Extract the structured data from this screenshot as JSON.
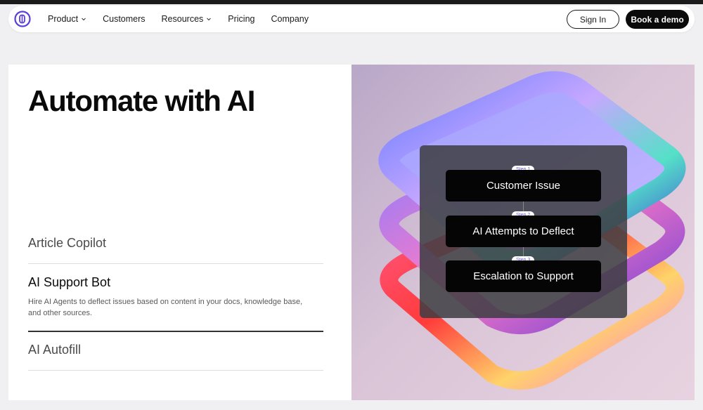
{
  "nav": {
    "items": [
      {
        "label": "Product",
        "dropdown": true
      },
      {
        "label": "Customers",
        "dropdown": false
      },
      {
        "label": "Resources",
        "dropdown": true
      },
      {
        "label": "Pricing",
        "dropdown": false
      },
      {
        "label": "Company",
        "dropdown": false
      }
    ],
    "signin_label": "Sign In",
    "demo_label": "Book a demo"
  },
  "hero": {
    "title": "Automate with AI"
  },
  "features": [
    {
      "title": "Article Copilot",
      "active": false
    },
    {
      "title": "AI Support Bot",
      "active": true,
      "description": "Hire AI Agents to deflect issues based on content in your docs, knowledge base, and other sources."
    },
    {
      "title": "AI Autofill",
      "active": false
    }
  ],
  "flow": {
    "steps": [
      {
        "tag": "Step 1",
        "label": "Customer Issue"
      },
      {
        "tag": "Step 2",
        "label": "AI Attempts to Deflect"
      },
      {
        "tag": "Step 3",
        "label": "Escalation to Support"
      }
    ]
  },
  "colors": {
    "brand": "#5b3fd6",
    "button_dark": "#0b0b0b",
    "page_bg": "#f0f0f2"
  },
  "icons": [
    "logo-icon",
    "chevron-down-icon"
  ]
}
